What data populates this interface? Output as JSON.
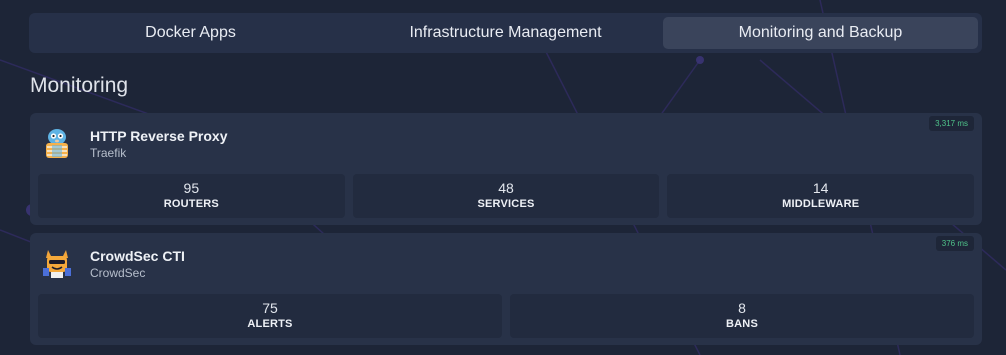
{
  "tabs": [
    {
      "label": "Docker Apps"
    },
    {
      "label": "Infrastructure Management"
    },
    {
      "label": "Monitoring and Backup"
    }
  ],
  "active_tab": "Monitoring and Backup",
  "section": {
    "title": "Monitoring"
  },
  "services": [
    {
      "name": "HTTP Reverse Proxy",
      "subtitle": "Traefik",
      "icon": "traefik-gopher-icon",
      "latency": "3,317 ms",
      "stats": [
        {
          "value": "95",
          "label": "ROUTERS"
        },
        {
          "value": "48",
          "label": "SERVICES"
        },
        {
          "value": "14",
          "label": "MIDDLEWARE"
        }
      ]
    },
    {
      "name": "CrowdSec CTI",
      "subtitle": "CrowdSec",
      "icon": "crowdsec-mascot-icon",
      "latency": "376 ms",
      "stats": [
        {
          "value": "75",
          "label": "ALERTS"
        },
        {
          "value": "8",
          "label": "BANS"
        }
      ]
    }
  ],
  "colors": {
    "background": "#1d2537",
    "card": "#283248",
    "stat_tile": "#222b3f",
    "latency_green": "#4fc48a"
  }
}
